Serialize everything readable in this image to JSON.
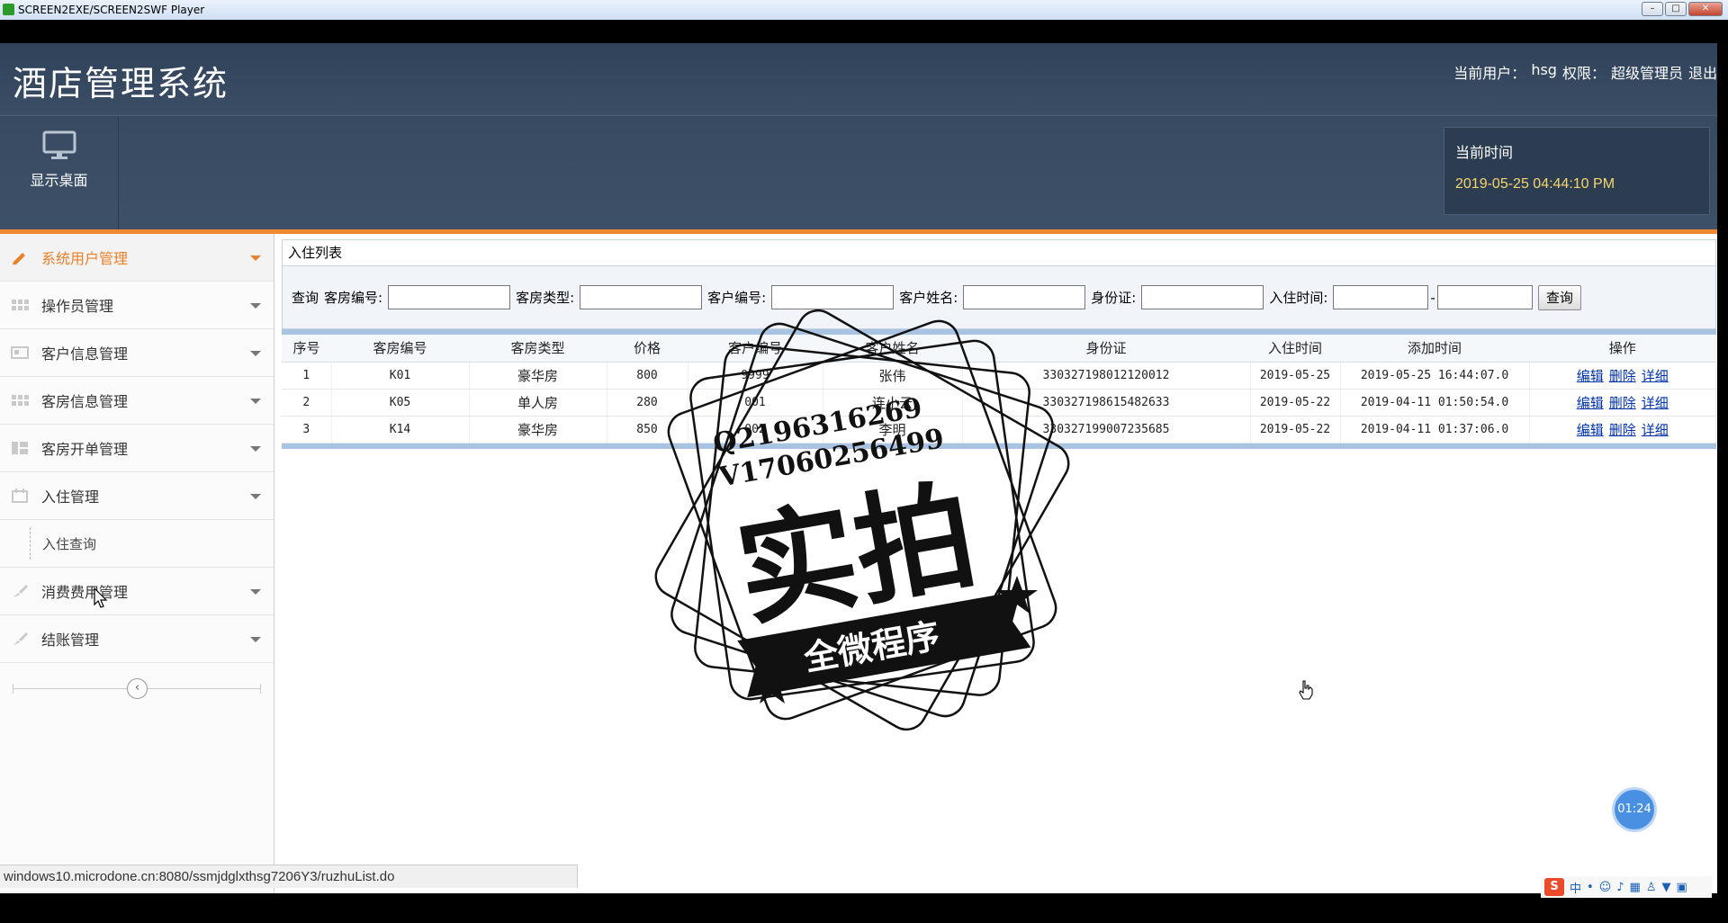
{
  "player": {
    "title": "SCREEN2EXE/SCREEN2SWF Player",
    "min_label": "–",
    "max_label": "□",
    "close_label": "✕"
  },
  "header": {
    "app_title": "酒店管理系统",
    "current_user_label": "当前用户：",
    "current_user": "hsg",
    "permission_label": "权限：",
    "permission": "超级管理员",
    "logout": "退出",
    "desktop_label": "显示桌面",
    "time_label": "当前时间",
    "time_value": "2019-05-25 04:44:10 PM"
  },
  "sidebar": {
    "items": [
      {
        "label": "系统用户管理",
        "active": true
      },
      {
        "label": "操作员管理"
      },
      {
        "label": "客户信息管理"
      },
      {
        "label": "客房信息管理"
      },
      {
        "label": "客房开单管理"
      },
      {
        "label": "入住管理"
      },
      {
        "label": "消费费用管理"
      },
      {
        "label": "结账管理"
      }
    ],
    "sub_item": "入住查询",
    "collapse_symbol": "‹"
  },
  "panel": {
    "title": "入住列表",
    "search": {
      "query_prefix": "查询",
      "room_no_label": "客房编号:",
      "room_type_label": "客房类型:",
      "customer_no_label": "客户编号:",
      "customer_name_label": "客户姓名:",
      "id_card_label": "身份证:",
      "checkin_time_label": "入住时间:",
      "range_dash": "-",
      "query_button": "查询"
    },
    "table": {
      "headers": [
        "序号",
        "客房编号",
        "客房类型",
        "价格",
        "客户编号",
        "客户姓名",
        "身份证",
        "入住时间",
        "添加时间",
        "操作"
      ],
      "rows": [
        {
          "no": "1",
          "room_no": "K01",
          "room_type": "豪华房",
          "price": "800",
          "customer_no": "9999",
          "customer_name": "张伟",
          "id_card": "330327198012120012",
          "checkin": "2019-05-25",
          "added": "2019-05-25 16:44:07.0"
        },
        {
          "no": "2",
          "room_no": "K05",
          "room_type": "单人房",
          "price": "280",
          "customer_no": "001",
          "customer_name": "连小云",
          "id_card": "330327198615482633",
          "checkin": "2019-05-22",
          "added": "2019-04-11 01:50:54.0"
        },
        {
          "no": "3",
          "room_no": "K14",
          "room_type": "豪华房",
          "price": "850",
          "customer_no": "002",
          "customer_name": "李明",
          "id_card": "330327199007235685",
          "checkin": "2019-05-22",
          "added": "2019-04-11 01:37:06.0"
        }
      ],
      "actions": {
        "edit": "编辑",
        "delete": "删除",
        "detail": "详细"
      }
    }
  },
  "watermark": {
    "line1": "Q2196316269",
    "line2": "V17060256499",
    "big_text": "实拍",
    "ribbon_text": "全微程序"
  },
  "overlay": {
    "timer": "01:24",
    "status_url": "windows10.microdone.cn:8080/ssmjdglxthsg7206Y3/ruzhuList.do",
    "ime_logo": "S",
    "ime_lang": "中"
  },
  "colors": {
    "header_bg": "#34475f",
    "accent_orange": "#f0882f",
    "time_yellow": "#f5d76e",
    "link_blue": "#0033aa"
  }
}
